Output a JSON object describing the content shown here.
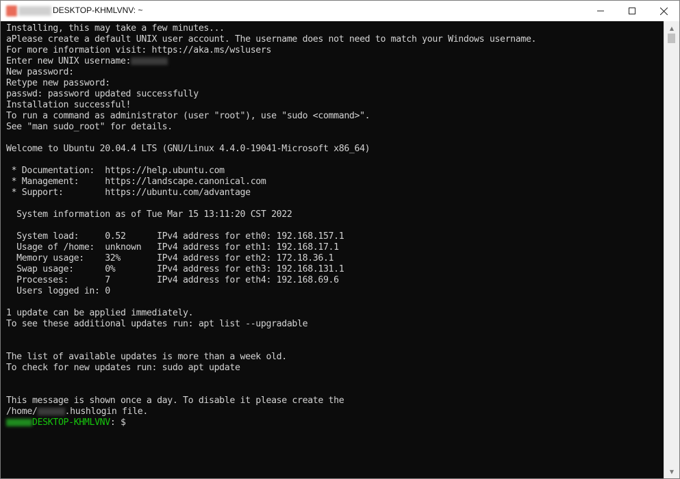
{
  "window": {
    "title": "DESKTOP-KHMLVNV: ~",
    "controls": {
      "minimize_icon": "minimize-icon",
      "maximize_icon": "maximize-icon",
      "close_icon": "close-icon"
    }
  },
  "terminal": {
    "lines": [
      "Installing, this may take a few minutes...",
      "aPlease create a default UNIX user account. The username does not need to match your Windows username.",
      "For more information visit: https://aka.ms/wslusers",
      "Enter new UNIX username:",
      "New password:",
      "Retype new password:",
      "passwd: password updated successfully",
      "Installation successful!",
      "To run a command as administrator (user \"root\"), use \"sudo <command>\".",
      "See \"man sudo_root\" for details.",
      "",
      "Welcome to Ubuntu 20.04.4 LTS (GNU/Linux 4.4.0-19041-Microsoft x86_64)",
      "",
      " * Documentation:  https://help.ubuntu.com",
      " * Management:     https://landscape.canonical.com",
      " * Support:        https://ubuntu.com/advantage",
      "",
      "  System information as of Tue Mar 15 13:11:20 CST 2022",
      "",
      "  System load:     0.52      IPv4 address for eth0: 192.168.157.1",
      "  Usage of /home:  unknown   IPv4 address for eth1: 192.168.17.1",
      "  Memory usage:    32%       IPv4 address for eth2: 172.18.36.1",
      "  Swap usage:      0%        IPv4 address for eth3: 192.168.131.1",
      "  Processes:       7         IPv4 address for eth4: 192.168.69.6",
      "  Users logged in: 0",
      "",
      "1 update can be applied immediately.",
      "To see these additional updates run: apt list --upgradable",
      "",
      "",
      "The list of available updates is more than a week old.",
      "To check for new updates run: sudo apt update",
      "",
      "",
      "This message is shown once a day. To disable it please create the"
    ],
    "hushlogin": {
      "prefix": "/home/",
      "suffix": ".hushlogin file."
    },
    "prompt": {
      "host": "DESKTOP-KHMLVNV",
      "sep": ":",
      "path": " ",
      "symbol": "$ "
    }
  },
  "colors": {
    "background": "#0c0c0c",
    "foreground": "#d4d4d4",
    "prompt_host": "#16c60c"
  }
}
